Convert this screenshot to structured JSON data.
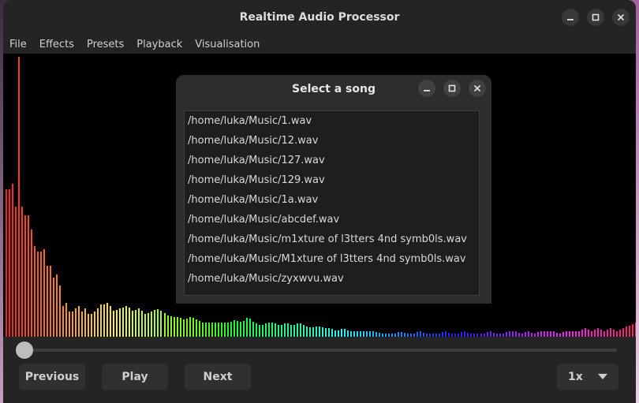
{
  "window": {
    "title": "Realtime Audio Processor",
    "minimize_icon": "minimize-icon",
    "maximize_icon": "maximize-icon",
    "close_icon": "close-icon"
  },
  "menu": [
    "File",
    "Effects",
    "Presets",
    "Playback",
    "Visualisation"
  ],
  "dialog": {
    "title": "Select a song",
    "songs": [
      "/home/luka/Music/1.wav",
      "/home/luka/Music/12.wav",
      "/home/luka/Music/127.wav",
      "/home/luka/Music/129.wav",
      "/home/luka/Music/1a.wav",
      "/home/luka/Music/abcdef.wav",
      "/home/luka/Music/m1xture of l3tters 4nd symb0ls.wav",
      "/home/luka/Music/M1xture of l3tters 4nd symb0ls.wav",
      "/home/luka/Music/zyxwvu.wav"
    ]
  },
  "controls": {
    "previous": "Previous",
    "play": "Play",
    "next": "Next",
    "speed": "1x",
    "playback_position": 0.0
  },
  "spectrum": {
    "levels": [
      0.52,
      0.54,
      0.46,
      0.99,
      0.46,
      0.43,
      0.38,
      0.32,
      0.3,
      0.3,
      0.31,
      0.25,
      0.21,
      0.22,
      0.18,
      0.11,
      0.12,
      0.09,
      0.1,
      0.11,
      0.09,
      0.1,
      0.08,
      0.09,
      0.1,
      0.08,
      0.07,
      0.07,
      0.06,
      0.07,
      0.06,
      0.05,
      0.05,
      0.05,
      0.05,
      0.05,
      0.06,
      0.05,
      0.07,
      0.05,
      0.04,
      0.05,
      0.05,
      0.04,
      0.05,
      0.04,
      0.05,
      0.04,
      0.03,
      0.04,
      0.03,
      0.03,
      0.02,
      0.03,
      0.02,
      0.02,
      0.02,
      0.02,
      0.02,
      0.01,
      0.01,
      0.01,
      0.02,
      0.01,
      0.01,
      0.02,
      0.01,
      0.01,
      0.01,
      0.02,
      0.01,
      0.01,
      0.02,
      0.01,
      0.01,
      0.01,
      0.02,
      0.01,
      0.01,
      0.02,
      0.02,
      0.01,
      0.02,
      0.01,
      0.02,
      0.02,
      0.02,
      0.01,
      0.02,
      0.02,
      0.02,
      0.03,
      0.02,
      0.03,
      0.02,
      0.03,
      0.02,
      0.03,
      0.04,
      0.05
    ]
  }
}
